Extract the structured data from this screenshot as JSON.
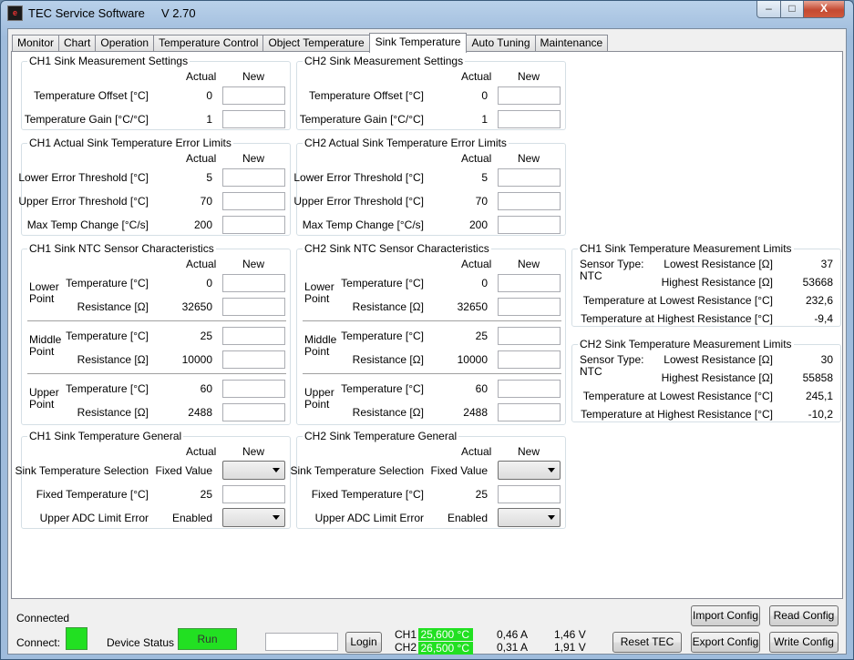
{
  "window": {
    "title": "TEC Service Software",
    "version": "V 2.70",
    "icon_name": "app-icon",
    "minimize_label": "–",
    "maximize_label": "□",
    "close_label": "X"
  },
  "tabs": [
    {
      "label": "Monitor"
    },
    {
      "label": "Chart"
    },
    {
      "label": "Operation"
    },
    {
      "label": "Temperature Control"
    },
    {
      "label": "Object Temperature"
    },
    {
      "label": "Sink Temperature",
      "active": true
    },
    {
      "label": "Auto Tuning"
    },
    {
      "label": "Maintenance"
    }
  ],
  "headers": {
    "actual": "Actual",
    "new": "New"
  },
  "ch1": {
    "meas_title": "CH1 Sink Measurement Settings",
    "limits_title": "CH1 Actual Sink Temperature Error Limits",
    "ntc_title": "CH1 Sink NTC Sensor Characteristics",
    "general_title": "CH1 Sink Temperature General"
  },
  "ch2": {
    "meas_title": "CH2 Sink Measurement Settings",
    "limits_title": "CH2 Actual Sink Temperature Error Limits",
    "ntc_title": "CH2 Sink NTC Sensor Characteristics",
    "general_title": "CH2 Sink Temperature General"
  },
  "labels": {
    "temp_offset": "Temperature Offset [°C]",
    "temp_gain": "Temperature Gain [°C/°C]",
    "lower_err": "Lower Error Threshold [°C]",
    "upper_err": "Upper Error Threshold [°C]",
    "max_change": "Max Temp Change [°C/s]",
    "lower_point_1": "Lower",
    "middle_point_1": "Middle",
    "upper_point_1": "Upper",
    "point_2": "Point",
    "ntc_temp": "Temperature [°C]",
    "ntc_res": "Resistance [Ω]",
    "sink_sel": "Sink Temperature Selection",
    "fixed_temp": "Fixed Temperature [°C]",
    "upper_adc": "Upper ADC Limit Error"
  },
  "values_ch1": {
    "temp_offset": "0",
    "temp_gain": "1",
    "lower_err": "5",
    "upper_err": "70",
    "max_change": "200",
    "lower_temp": "0",
    "lower_res": "32650",
    "middle_temp": "25",
    "middle_res": "10000",
    "upper_temp": "60",
    "upper_res": "2488",
    "sink_sel": "Fixed Value",
    "fixed_temp": "25",
    "upper_adc": "Enabled"
  },
  "values_ch2": {
    "temp_offset": "0",
    "temp_gain": "1",
    "lower_err": "5",
    "upper_err": "70",
    "max_change": "200",
    "lower_temp": "0",
    "lower_res": "32650",
    "middle_temp": "25",
    "middle_res": "10000",
    "upper_temp": "60",
    "upper_res": "2488",
    "sink_sel": "Fixed Value",
    "fixed_temp": "25",
    "upper_adc": "Enabled"
  },
  "meas_limits": {
    "ch1_title": "CH1 Sink Temperature Measurement Limits",
    "ch2_title": "CH2 Sink Temperature Measurement Limits",
    "sensor_type_label": "Sensor Type:",
    "lowest_res_label": "Lowest Resistance [Ω]",
    "highest_res_label": "Highest Resistance [Ω]",
    "temp_lowest_label": "Temperature at Lowest Resistance [°C]",
    "temp_highest_label": "Temperature at Highest Resistance [°C]",
    "ch1": {
      "sensor_type": "NTC",
      "lowest_res": "37",
      "highest_res": "53668",
      "temp_lowest": "232,6",
      "temp_highest": "-9,4"
    },
    "ch2": {
      "sensor_type": "NTC",
      "lowest_res": "30",
      "highest_res": "55858",
      "temp_lowest": "245,1",
      "temp_highest": "-10,2"
    }
  },
  "status": {
    "connected_text": "Connected",
    "connect_label": "Connect:",
    "device_status_label": "Device Status",
    "device_status_value": "Run",
    "login_input_value": "",
    "login_label": "Login",
    "ch1_label": "CH1",
    "ch2_label": "CH2",
    "ch1_temp": "25,600 °C",
    "ch2_temp": "26,500 °C",
    "ch1_current": "0,46 A",
    "ch2_current": "0,31 A",
    "ch1_voltage": "1,46 V",
    "ch2_voltage": "1,91 V",
    "led_color": "#22e022"
  },
  "buttons": {
    "import_config": "Import Config",
    "read_config": "Read Config",
    "reset_tec": "Reset TEC",
    "export_config": "Export Config",
    "write_config": "Write Config"
  }
}
